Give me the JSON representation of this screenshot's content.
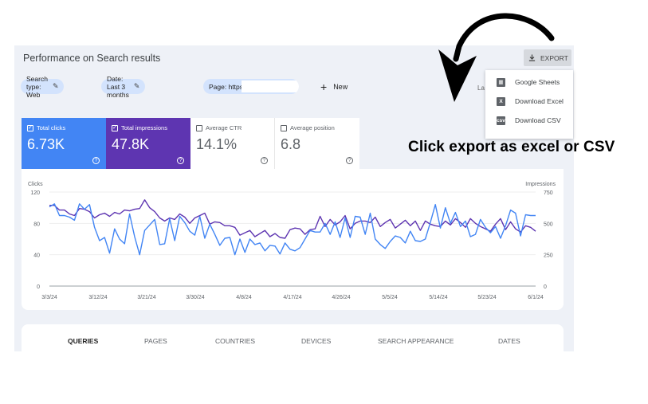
{
  "header": {
    "title": "Performance on Search results",
    "export_label": "EXPORT"
  },
  "filters": {
    "search_type": "Search type: Web",
    "date": "Date: Last 3 months",
    "page_prefix": "Page: https:/",
    "new_label": "New",
    "cut_text": "La"
  },
  "metrics": [
    {
      "label": "Total clicks",
      "value": "6.73K",
      "checked": true,
      "color": "#4285f4"
    },
    {
      "label": "Total impressions",
      "value": "47.8K",
      "checked": true,
      "color": "#5e35b1"
    },
    {
      "label": "Average CTR",
      "value": "14.1%",
      "checked": false
    },
    {
      "label": "Average position",
      "value": "6.8",
      "checked": false
    }
  ],
  "export_menu": [
    {
      "label": "Google Sheets",
      "icon": "sheets-icon"
    },
    {
      "label": "Download Excel",
      "icon": "excel-icon"
    },
    {
      "label": "Download CSV",
      "icon": "csv-icon"
    }
  ],
  "tabs": [
    "QUERIES",
    "PAGES",
    "COUNTRIES",
    "DEVICES",
    "SEARCH APPEARANCE",
    "DATES"
  ],
  "annotation": "Click export as excel or CSV",
  "chart_data": {
    "type": "line",
    "left_axis_label": "Clicks",
    "right_axis_label": "Impressions",
    "left_ticks": [
      0,
      40,
      80,
      120
    ],
    "right_ticks": [
      0,
      250,
      500,
      750
    ],
    "ylim_left": [
      0,
      120
    ],
    "ylim_right": [
      0,
      750
    ],
    "x_tick_labels": [
      "3/3/24",
      "3/12/24",
      "3/21/24",
      "3/30/24",
      "4/8/24",
      "4/17/24",
      "4/26/24",
      "5/5/24",
      "5/14/24",
      "5/23/24",
      "6/1/24"
    ],
    "series": [
      {
        "name": "Clicks",
        "axis": "left",
        "color": "#4285f4",
        "values": [
          101,
          105,
          90,
          90,
          88,
          84,
          105,
          98,
          104,
          75,
          58,
          62,
          42,
          73,
          60,
          54,
          92,
          63,
          40,
          71,
          78,
          85,
          53,
          54,
          86,
          58,
          89,
          81,
          70,
          65,
          89,
          61,
          79,
          66,
          52,
          61,
          62,
          40,
          60,
          43,
          60,
          53,
          55,
          45,
          52,
          51,
          41,
          55,
          47,
          45,
          49,
          60,
          71,
          69,
          69,
          80,
          66,
          82,
          62,
          87,
          62,
          89,
          88,
          66,
          93,
          60,
          53,
          48,
          57,
          64,
          62,
          55,
          70,
          58,
          57,
          60,
          81,
          104,
          74,
          100,
          80,
          94,
          76,
          83,
          63,
          66,
          85,
          75,
          68,
          76,
          61,
          77,
          97,
          93,
          64,
          91,
          90,
          90
        ]
      },
      {
        "name": "Impressions",
        "axis": "left",
        "color": "#5e35b1",
        "values": [
          103,
          103,
          97,
          97,
          92,
          90,
          99,
          98,
          95,
          87,
          91,
          93,
          89,
          94,
          92,
          97,
          96,
          98,
          99,
          110,
          100,
          95,
          87,
          83,
          87,
          85,
          92,
          88,
          80,
          87,
          90,
          93,
          79,
          82,
          81,
          77,
          77,
          75,
          65,
          68,
          71,
          63,
          67,
          71,
          63,
          67,
          62,
          61,
          72,
          74,
          73,
          66,
          72,
          73,
          89,
          76,
          85,
          78,
          82,
          90,
          73,
          80,
          83,
          83,
          81,
          88,
          76,
          81,
          85,
          74,
          79,
          84,
          77,
          83,
          71,
          83,
          79,
          77,
          76,
          83,
          78,
          86,
          81,
          75,
          86,
          80,
          76,
          73,
          70,
          79,
          86,
          72,
          82,
          73,
          69,
          77,
          75,
          70
        ]
      }
    ]
  }
}
